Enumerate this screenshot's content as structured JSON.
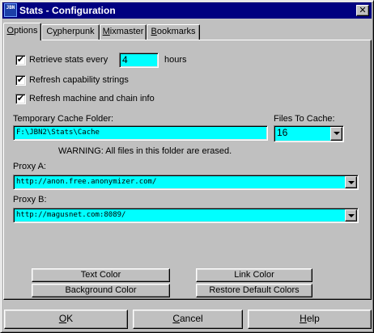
{
  "window": {
    "title": "Stats - Configuration",
    "app_icon_text": "JBN"
  },
  "tabs": [
    {
      "pre": "",
      "key": "O",
      "post": "ptions"
    },
    {
      "pre": "C",
      "key": "y",
      "post": "pherpunk"
    },
    {
      "pre": "",
      "key": "M",
      "post": "ixmaster"
    },
    {
      "pre": "",
      "key": "B",
      "post": "ookmarks"
    }
  ],
  "options": {
    "retrieve_stats": {
      "label": "Retrieve stats every",
      "checked": "✔",
      "value": "4",
      "unit": "hours"
    },
    "refresh_capability": {
      "label": "Refresh capability strings",
      "checked": "✔"
    },
    "refresh_machine": {
      "label": "Refresh machine and chain info",
      "checked": "✔"
    },
    "cache_folder": {
      "label": "Temporary Cache Folder:",
      "value": "F:\\JBN2\\Stats\\Cache",
      "warning": "WARNING: All files in this folder are erased."
    },
    "files_to_cache": {
      "label": "Files To Cache:",
      "value": "16"
    },
    "proxy_a": {
      "label": "Proxy A:",
      "value": "http://anon.free.anonymizer.com/"
    },
    "proxy_b": {
      "label": "Proxy B:",
      "value": "http://magusnet.com:8089/"
    },
    "color_buttons": {
      "text_color": "Text Color",
      "link_color": "Link Color",
      "background_color": "Background Color",
      "restore_defaults": "Restore Default Colors"
    }
  },
  "footer": {
    "ok": {
      "key": "O",
      "post": "K"
    },
    "cancel": {
      "key": "C",
      "post": "ancel"
    },
    "help": {
      "key": "H",
      "post": "elp"
    }
  },
  "colors": {
    "title_bar": "#000080",
    "field_bg": "#00ffff",
    "face": "#c0c0c0"
  }
}
